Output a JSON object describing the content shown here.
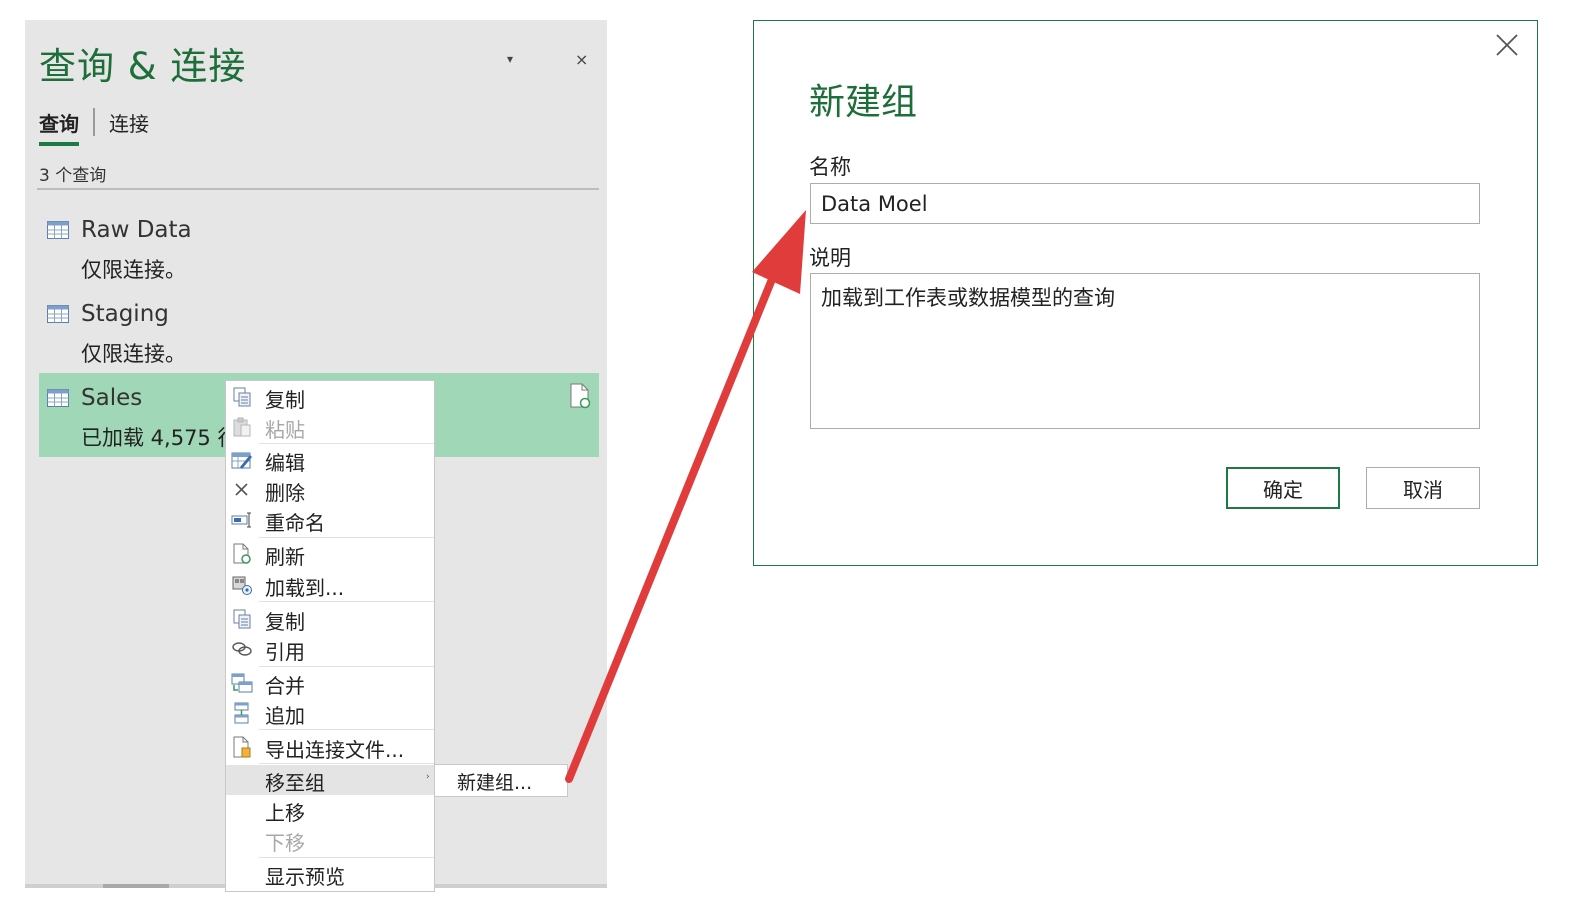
{
  "queries_pane": {
    "title": "查询 & 连接",
    "dropdown_glyph": "▾",
    "close_glyph": "×",
    "tabs": {
      "queries": "查询",
      "connections": "连接"
    },
    "count_label": "3 个查询",
    "items": [
      {
        "name": "Raw Data",
        "status": "仅限连接。"
      },
      {
        "name": "Staging",
        "status": "仅限连接。"
      },
      {
        "name": "Sales",
        "status": "已加载 4,575 行"
      }
    ]
  },
  "context_menu": {
    "items": [
      {
        "label": "复制",
        "icon": "copy-icon",
        "enabled": true
      },
      {
        "label": "粘贴",
        "icon": "paste-icon",
        "enabled": false
      },
      {
        "label": "编辑",
        "icon": "edit-icon",
        "enabled": true
      },
      {
        "label": "删除",
        "icon": "delete-icon",
        "enabled": true
      },
      {
        "label": "重命名",
        "icon": "rename-icon",
        "enabled": true
      },
      {
        "label": "刷新",
        "icon": "refresh-icon",
        "enabled": true
      },
      {
        "label": "加载到...",
        "icon": "load-to-icon",
        "enabled": true
      },
      {
        "label": "复制",
        "icon": "duplicate-icon",
        "enabled": true
      },
      {
        "label": "引用",
        "icon": "reference-icon",
        "enabled": true
      },
      {
        "label": "合并",
        "icon": "merge-icon",
        "enabled": true
      },
      {
        "label": "追加",
        "icon": "append-icon",
        "enabled": true
      },
      {
        "label": "导出连接文件...",
        "icon": "export-icon",
        "enabled": true
      },
      {
        "label": "移至组",
        "icon": "",
        "enabled": true,
        "submenu_arrow": "›"
      },
      {
        "label": "上移",
        "icon": "",
        "enabled": true
      },
      {
        "label": "下移",
        "icon": "",
        "enabled": false
      },
      {
        "label": "显示预览",
        "icon": "",
        "enabled": true
      }
    ],
    "submenu": {
      "label": "新建组..."
    }
  },
  "dialog": {
    "title": "新建组",
    "name_label": "名称",
    "name_value": "Data Moel",
    "description_label": "说明",
    "description_value": "加载到工作表或数据模型的查询",
    "ok_label": "确定",
    "cancel_label": "取消"
  },
  "colors": {
    "accent_green": "#1e6e3a",
    "selection_green": "#9fd7b7",
    "annotation_arrow": "#e03c3c"
  }
}
